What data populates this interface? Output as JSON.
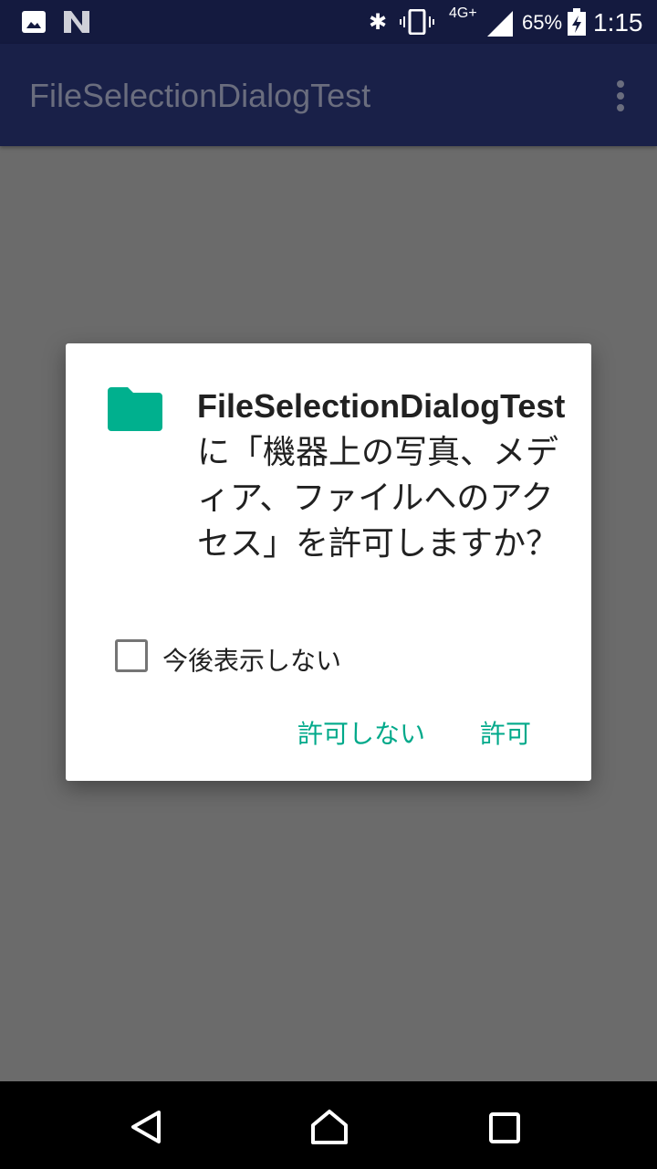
{
  "status_bar": {
    "network": "4G+",
    "battery": "65%",
    "time": "1:15"
  },
  "app_bar": {
    "title": "FileSelectionDialogTest"
  },
  "dialog": {
    "app_name": "FileSelectionDialogTest",
    "message": " に「機器上の写真、メディア、ファイルへのアクセス」を許可しますか？",
    "checkbox_label": "今後表示しない",
    "checkbox_checked": false,
    "deny_label": "許可しない",
    "allow_label": "許可",
    "accent": "#00a98a"
  }
}
